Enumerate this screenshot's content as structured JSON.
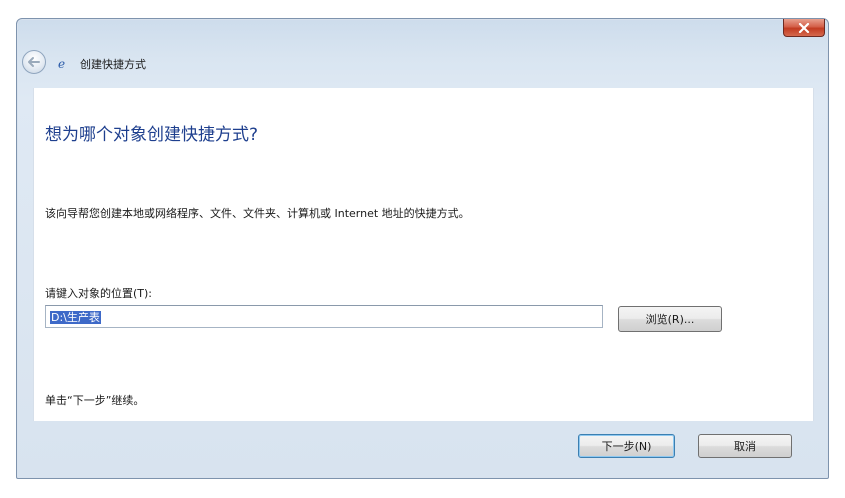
{
  "window": {
    "title": "创建快捷方式"
  },
  "main": {
    "heading": "想为哪个对象创建快捷方式?",
    "description": "该向导帮您创建本地或网络程序、文件、文件夹、计算机或 Internet 地址的快捷方式。",
    "location_label": "请键入对象的位置(T):",
    "location_value": "D:\\生产表",
    "browse_label": "浏览(R)...",
    "continue_hint": "单击“下一步”继续。"
  },
  "footer": {
    "next_label": "下一步(N)",
    "cancel_label": "取消"
  },
  "icons": {
    "close": "close-icon",
    "back": "back-arrow-icon",
    "app": "ie-icon"
  },
  "colors": {
    "heading": "#1e3f8e",
    "selection": "#3d69c8",
    "close_button": "#c23b21"
  }
}
